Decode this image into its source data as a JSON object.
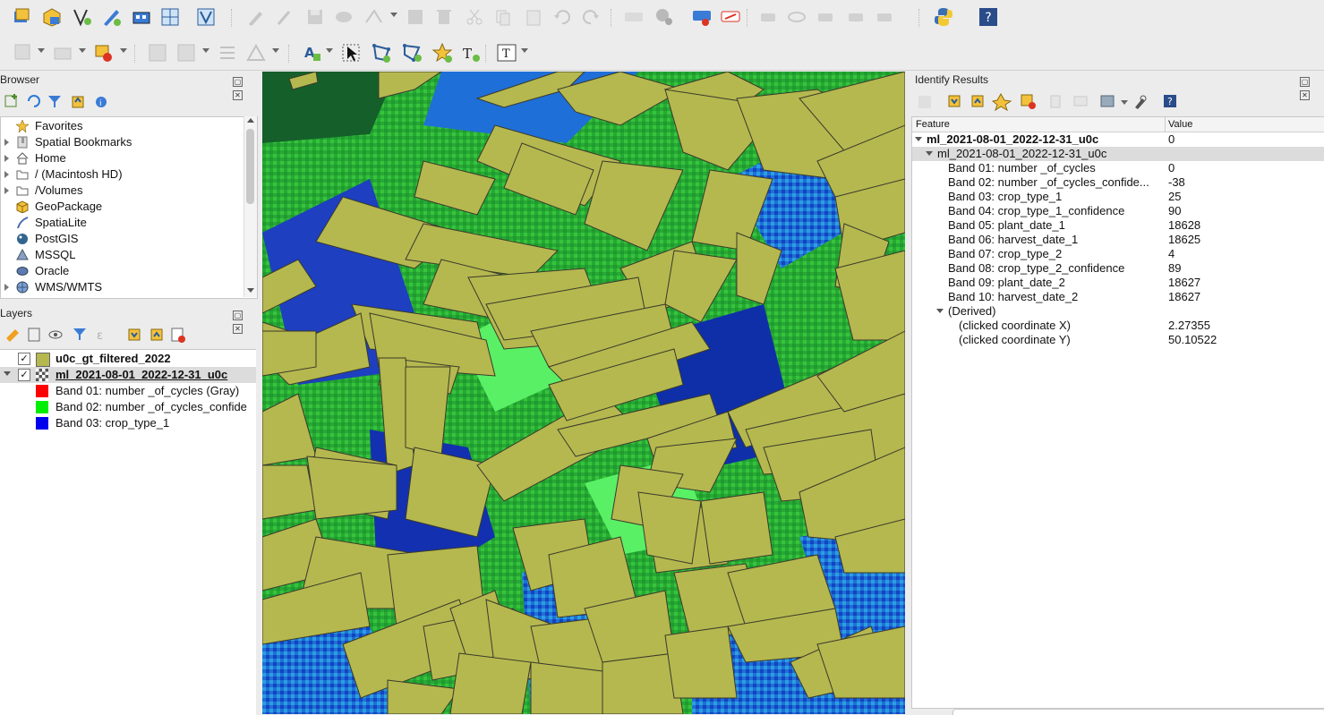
{
  "browser": {
    "title": "Browser",
    "items": [
      {
        "label": "Favorites",
        "icon": "star-icon",
        "expandable": false
      },
      {
        "label": "Spatial Bookmarks",
        "icon": "bookmark-icon",
        "expandable": true
      },
      {
        "label": "Home",
        "icon": "home-icon",
        "expandable": true
      },
      {
        "label": "/ (Macintosh HD)",
        "icon": "folder-icon",
        "expandable": true
      },
      {
        "label": "/Volumes",
        "icon": "folder-icon",
        "expandable": true
      },
      {
        "label": "GeoPackage",
        "icon": "geopackage-icon",
        "expandable": false
      },
      {
        "label": "SpatiaLite",
        "icon": "spatialite-icon",
        "expandable": false
      },
      {
        "label": "PostGIS",
        "icon": "postgis-icon",
        "expandable": false
      },
      {
        "label": "MSSQL",
        "icon": "mssql-icon",
        "expandable": false
      },
      {
        "label": "Oracle",
        "icon": "oracle-icon",
        "expandable": false
      },
      {
        "label": "WMS/WMTS",
        "icon": "globe-icon",
        "expandable": true
      }
    ]
  },
  "layers": {
    "title": "Layers",
    "items": [
      {
        "label": "u0c_gt_filtered_2022",
        "checked": true,
        "color": "#b5b84f"
      },
      {
        "label": "ml_2021-08-01_2022-12-31_u0c",
        "checked": true,
        "color": "raster"
      }
    ],
    "bands": [
      {
        "label": "Band 01: number _of_cycles (Gray)",
        "color": "#ff0000"
      },
      {
        "label": "Band 02: number _of_cycles_confide",
        "color": "#00ee00"
      },
      {
        "label": "Band 03: crop_type_1",
        "color": "#0000ee"
      }
    ]
  },
  "identify": {
    "title": "Identify Results",
    "col_feature": "Feature",
    "col_value": "Value",
    "layer_name": "ml_2021-08-01_2022-12-31_u0c",
    "layer_value": "0",
    "sub_name": "ml_2021-08-01_2022-12-31_u0c",
    "bands": [
      {
        "k": "Band 01: number _of_cycles",
        "v": "0"
      },
      {
        "k": "Band 02: number _of_cycles_confide...",
        "v": "-38"
      },
      {
        "k": "Band 03: crop_type_1",
        "v": "25"
      },
      {
        "k": "Band 04: crop_type_1_confidence",
        "v": "90"
      },
      {
        "k": "Band 05: plant_date_1",
        "v": "18628"
      },
      {
        "k": "Band 06: harvest_date_1",
        "v": "18625"
      },
      {
        "k": "Band 07: crop_type_2",
        "v": "4"
      },
      {
        "k": "Band 08: crop_type_2_confidence",
        "v": "89"
      },
      {
        "k": "Band 09: plant_date_2",
        "v": "18627"
      },
      {
        "k": "Band 10: harvest_date_2",
        "v": "18627"
      }
    ],
    "derived": "(Derived)",
    "coord_x_label": "(clicked coordinate X)",
    "coord_x": "2.27355",
    "coord_y_label": "(clicked coordinate Y)",
    "coord_y": "50.10522"
  },
  "toolbar": {
    "icons_row1": [
      "open-project-icon",
      "new-geopackage-icon",
      "new-vector-icon",
      "digitize-icon",
      "plugin-icon",
      "layout-icon",
      "style-manager-icon",
      "edit-pencil-icon",
      "pencil-icon",
      "save-edits-icon",
      "add-feature-icon",
      "node-tool-icon",
      "field-calc-icon",
      "delete-icon",
      "cut-icon",
      "copy-icon",
      "paste-icon",
      "undo-icon",
      "redo-icon",
      "label-icon",
      "label-pin-icon",
      "label-highlight-icon",
      "label-red-icon",
      "label-move-icon",
      "label-show-icon",
      "label-rotate-icon",
      "label-change-icon",
      "label-props-icon",
      "python-icon",
      "help-icon"
    ],
    "icons_row2": [
      "select-feature-icon",
      "deselect-icon",
      "filter-icon",
      "edit-attr-icon",
      "move-icon",
      "rotate-icon",
      "simplify-icon",
      "label-tool-icon",
      "pointer-icon",
      "add-ring-icon",
      "add-part-icon",
      "star-icon",
      "text-annotation-icon",
      "text-format-icon"
    ],
    "accent_color": "#b5b84f"
  }
}
